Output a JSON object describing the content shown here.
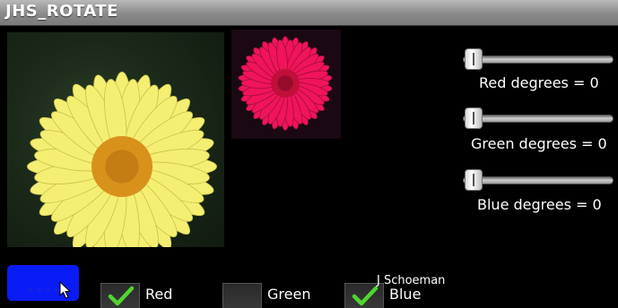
{
  "app": {
    "title": "JHS_ROTATE"
  },
  "images": {
    "original": "yellow-daisy-image",
    "rotated": "pink-daisy-image"
  },
  "sliders": [
    {
      "label": "Red degrees = 0",
      "value": 0
    },
    {
      "label": "Green degrees = 0",
      "value": 0
    },
    {
      "label": "Blue degrees = 0",
      "value": 0
    }
  ],
  "button": {
    "label": "----"
  },
  "checkboxes": [
    {
      "label": "Red",
      "checked": true
    },
    {
      "label": "Green",
      "checked": false
    },
    {
      "label": "Blue",
      "checked": true
    }
  ],
  "author": "J Schoeman",
  "colors": {
    "button_blue": "#0a1cf5",
    "check_green": "#4fd630",
    "daisy_yellow": "#f4ef72",
    "daisy_center": "#d8921c",
    "pink_petals": "#f0145a"
  }
}
